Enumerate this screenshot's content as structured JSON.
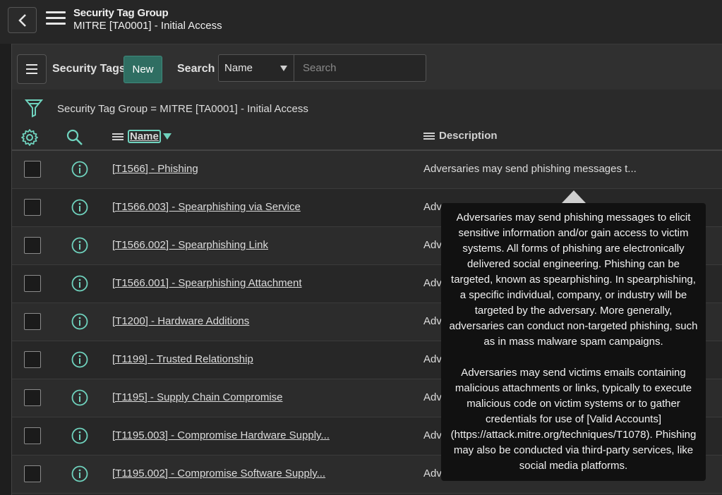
{
  "header": {
    "title": "Security Tag Group",
    "subtitle": "MITRE [TA0001] - Initial Access"
  },
  "toolbar": {
    "list_title": "Security Tags",
    "new_label": "New",
    "search_label": "Search",
    "search_field_value": "Name",
    "search_placeholder": "Search"
  },
  "filter": {
    "text": "Security Tag Group = MITRE [TA0001] - Initial Access"
  },
  "columns": {
    "name": "Name",
    "description": "Description"
  },
  "rows": [
    {
      "name": "[T1566] - Phishing",
      "description": "Adversaries may send phishing messages t..."
    },
    {
      "name": "[T1566.003] - Spearphishing via Service",
      "description": "Adv"
    },
    {
      "name": "[T1566.002] - Spearphishing Link",
      "description": "Adv"
    },
    {
      "name": "[T1566.001] - Spearphishing Attachment",
      "description": "Adv"
    },
    {
      "name": "[T1200] - Hardware Additions",
      "description": "Adv"
    },
    {
      "name": "[T1199] - Trusted Relationship",
      "description": "Adv"
    },
    {
      "name": "[T1195] - Supply Chain Compromise",
      "description": "Adv"
    },
    {
      "name": "[T1195.003] - Compromise Hardware Supply...",
      "description": "Adv"
    },
    {
      "name": "[T1195.002] - Compromise Software Supply...",
      "description": "Adv"
    }
  ],
  "tooltip": {
    "paragraph1": "Adversaries may send phishing messages to elicit sensitive information and/or gain access to victim systems. All forms of phishing are electronically delivered social engineering. Phishing can be targeted, known as spearphishing. In spearphishing, a specific individual, company, or industry will be targeted by the adversary. More generally, adversaries can conduct non-targeted phishing, such as in mass malware spam campaigns.",
    "paragraph2": "Adversaries may send victims emails containing malicious attachments or links, typically to execute malicious code on victim systems or to gather credentials for use of [Valid Accounts](https://attack.mitre.org/techniques/T1078). Phishing may also be conducted via third-party services, like social media platforms."
  },
  "colors": {
    "accent": "#6fd3be",
    "new_button": "#2f6e62"
  },
  "icons": {
    "back": "chevron-left-icon",
    "menu": "hamburger-icon",
    "filter": "funnel-icon",
    "settings": "gear-icon",
    "search": "magnifier-icon",
    "info": "info-circle-icon"
  }
}
